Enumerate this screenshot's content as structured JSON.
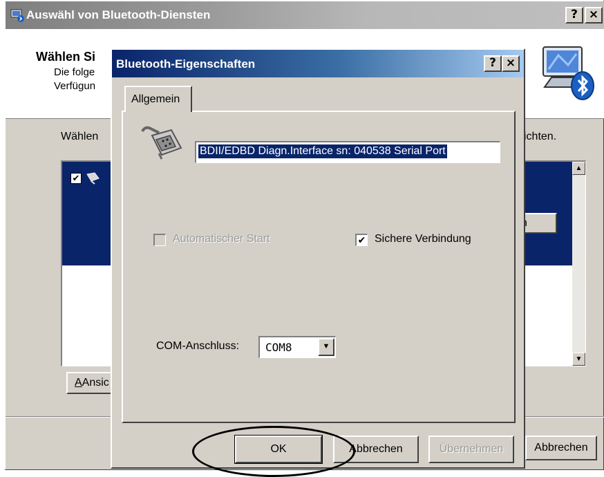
{
  "background_window": {
    "title": "Auswähl von Bluetooth-Diensten",
    "help_button": "?",
    "close_button": "×",
    "header_title": "Wählen Si",
    "header_line1": "Die folge",
    "header_line2": "Verfügun",
    "instruction": "Wählen",
    "instruction_right": "ichten.",
    "list_item_checked": "✔",
    "button_right_partial": "n",
    "button_ansicht_partial": "Ansic",
    "cancel_label": "Abbrechen",
    "scroll_up": "▲",
    "scroll_down": "▼"
  },
  "dialog": {
    "title": "Bluetooth-Eigenschaften",
    "help_button": "?",
    "close_button": "×",
    "tab_general": "Allgemein",
    "service_name": "BDII/EDBD Diagn.Interface  sn: 040538 Serial Port",
    "auto_start_label": "Automatischer Start",
    "auto_start_checked": false,
    "secure_connection_label": "Sichere Verbindung",
    "secure_connection_checked": "✔",
    "com_port_label": "COM-Anschluss:",
    "com_port_value": "COM8",
    "com_dropdown_arrow": "▼",
    "ok_label": "OK",
    "cancel_label": "Abbrechen",
    "apply_label": "Übernehmen"
  }
}
